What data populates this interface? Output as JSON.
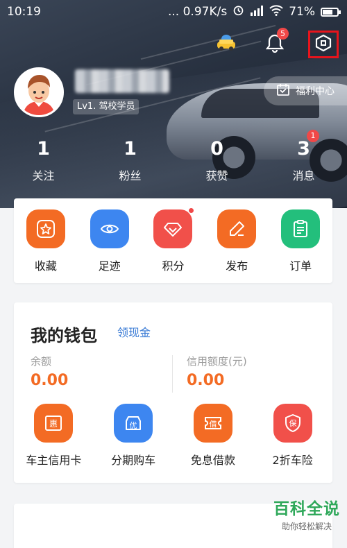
{
  "status_bar": {
    "time": "10:19",
    "speed": "... 0.97K/s",
    "battery": "71%",
    "battery_level": 0.71
  },
  "header": {
    "notification_count": "5",
    "level_tag": "Lv1. 驾校学员",
    "welfare_label": "福利中心",
    "stats": [
      {
        "value": "1",
        "label": "关注"
      },
      {
        "value": "1",
        "label": "粉丝"
      },
      {
        "value": "0",
        "label": "获赞"
      },
      {
        "value": "3",
        "label": "消息",
        "badge": "1"
      }
    ]
  },
  "quick_actions": [
    {
      "label": "收藏",
      "icon": "star-icon",
      "color": "#f36b24"
    },
    {
      "label": "足迹",
      "icon": "eye-icon",
      "color": "#3d86f0"
    },
    {
      "label": "积分",
      "icon": "diamond-icon",
      "color": "#f1504a"
    },
    {
      "label": "发布",
      "icon": "pencil-icon",
      "color": "#f36b24"
    },
    {
      "label": "订单",
      "icon": "clipboard-icon",
      "color": "#23bf7c"
    }
  ],
  "wallet": {
    "title": "我的钱包",
    "link": "领现金",
    "balance_label": "余额",
    "balance_value": "0.00",
    "credit_label": "信用额度(元)",
    "credit_value": "0.00",
    "services": [
      {
        "label": "车主信用卡",
        "glyph": "惠",
        "color": "#f36b24"
      },
      {
        "label": "分期购车",
        "glyph": "优",
        "color": "#3d86f0"
      },
      {
        "label": "免息借款",
        "glyph": "借",
        "color": "#f36b24"
      },
      {
        "label": "2折车险",
        "glyph": "保",
        "color": "#f1504a"
      }
    ]
  },
  "watermark": {
    "title": "百科全说",
    "subtitle": "助你轻松解决"
  }
}
